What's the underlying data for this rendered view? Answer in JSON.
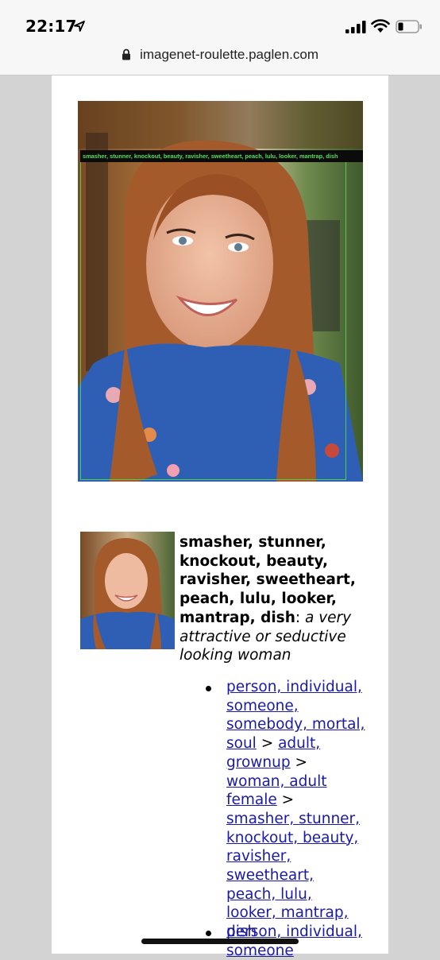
{
  "status_bar": {
    "time": "22:17"
  },
  "browser": {
    "url": "imagenet-roulette.paglen.com"
  },
  "detection": {
    "label": "smasher, stunner, knockout, beauty, ravisher, sweetheart, peach, lulu, looker, mantrap, dish"
  },
  "result": {
    "title": "smasher, stunner, knockout, beauty, ravisher, sweetheart, peach, lulu, looker, mantrap, dish",
    "separator": ": ",
    "definition": "a very attractive or seductive looking woman"
  },
  "hierarchy": [
    {
      "links": [
        "person, individual, someone, somebody, mortal, soul",
        "adult, grownup",
        "woman, adult female",
        "smasher, stunner, knockout, beauty, ravisher, sweetheart, peach, lulu, looker, mantrap, dish"
      ],
      "sep": " > "
    },
    {
      "links": [
        "person, individual, someone"
      ]
    }
  ]
}
